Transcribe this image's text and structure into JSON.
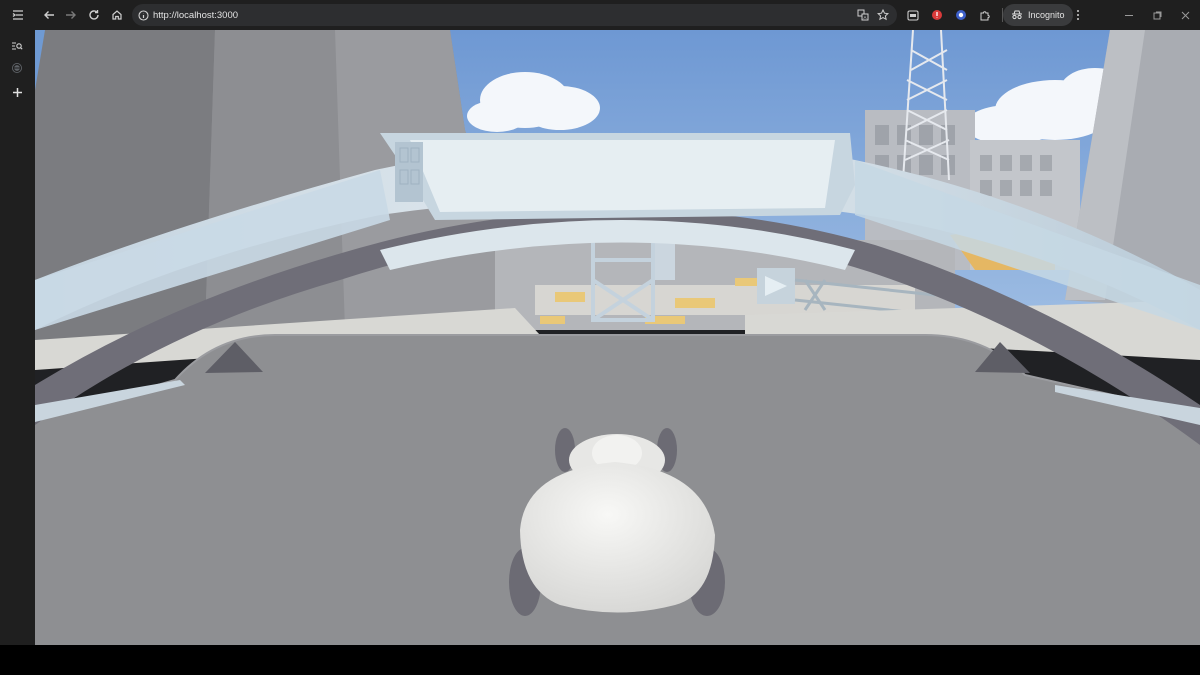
{
  "browser": {
    "url": "http://localhost:3000",
    "profile_label": "Incognito",
    "nav_icons": [
      "back-arrow-icon",
      "forward-arrow-icon",
      "reload-icon",
      "home-icon"
    ],
    "omnibox_icons": [
      "site-info-icon",
      "translate-icon",
      "bookmark-star-icon"
    ],
    "extension_icons": [
      "screen-capture-icon",
      "red-extension-icon",
      "blue-extension-icon",
      "puzzle-extensions-icon"
    ],
    "window_controls": [
      "minimize-icon",
      "restore-icon",
      "close-icon"
    ]
  },
  "sidebar": {
    "items": [
      "tab-list-icon",
      "tab-search-icon",
      "globe-icon",
      "new-tab-plus-icon"
    ]
  },
  "scene": {
    "description_colors": {
      "sky": "#7aa3d8",
      "road": "#8e8f92",
      "arch": "#d9e3ea",
      "arch_dark": "#6f6e78",
      "player": "#eeeeec",
      "yellow_marking": "#e9c878"
    }
  }
}
